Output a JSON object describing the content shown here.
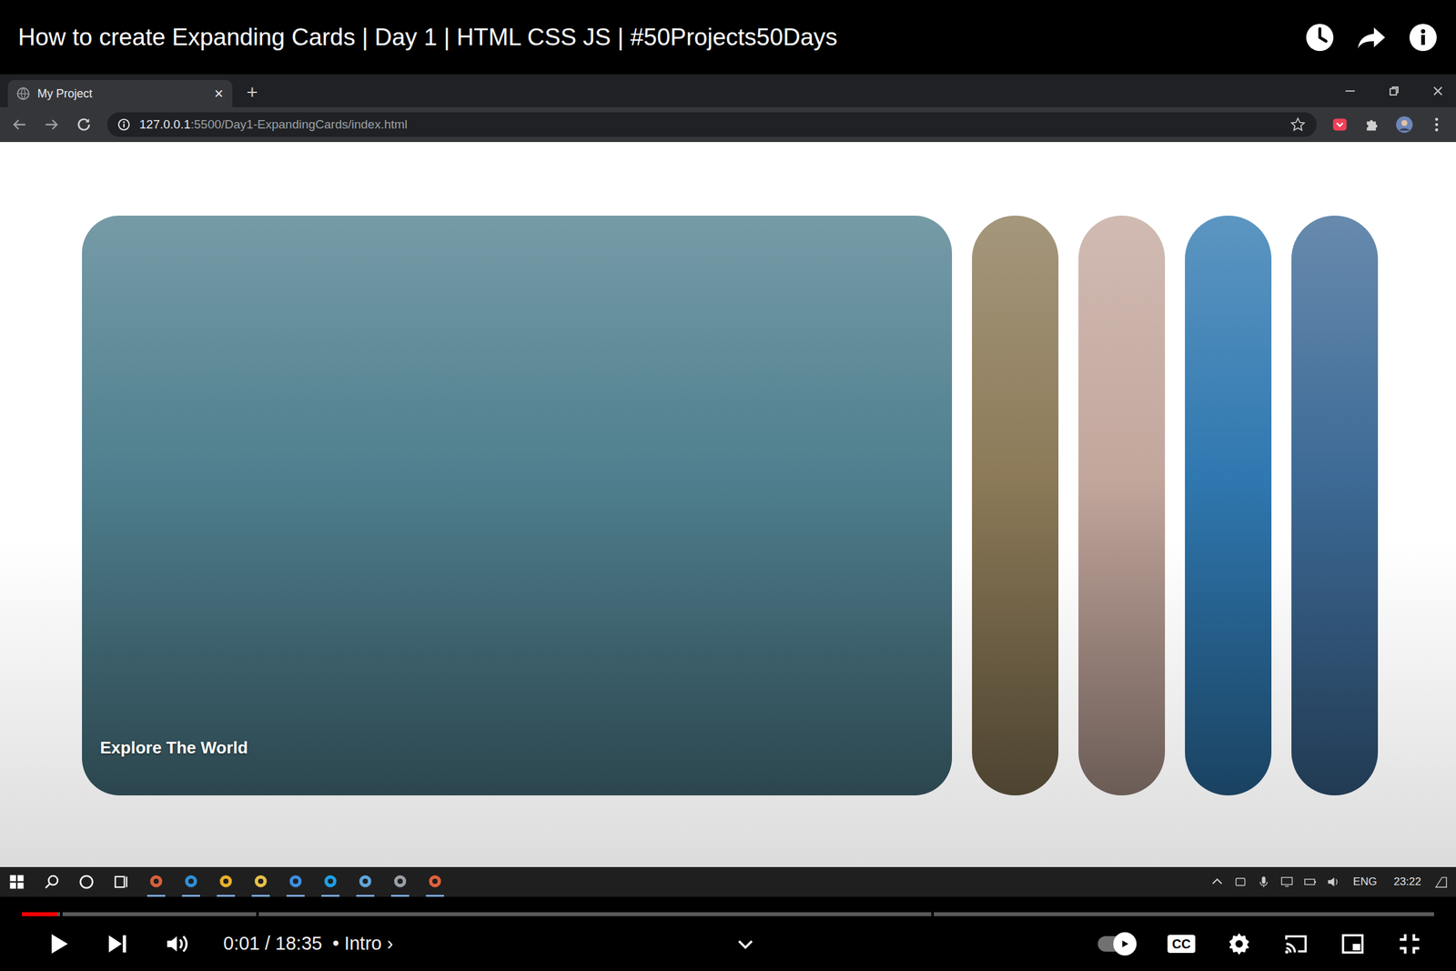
{
  "video": {
    "title": "How to create Expanding Cards | Day 1 | HTML CSS JS | #50Projects50Days"
  },
  "browser": {
    "tab": {
      "label": "My Project",
      "close": "×"
    },
    "new_tab": "+",
    "url": {
      "host": "127.0.0.1",
      "rest": ":5500/Day1-ExpandingCards/index.html"
    }
  },
  "cards": [
    {
      "title": "Explore The World",
      "selected": true,
      "color": "#4f7f8e"
    },
    {
      "title": "",
      "selected": false,
      "color": "#8c7a58"
    },
    {
      "title": "",
      "selected": false,
      "color": "#c3a79d"
    },
    {
      "title": "",
      "selected": false,
      "color": "#2f78b0"
    },
    {
      "title": "",
      "selected": false,
      "color": "#3d6a96"
    }
  ],
  "taskbar": {
    "language": "ENG",
    "time": "23:22"
  },
  "player": {
    "time": "0:01 / 18:35",
    "chapter": "• Intro",
    "chapter_arrow": "›",
    "level": 0.025,
    "segments": [
      0.027,
      0.138,
      0.479,
      0.356
    ],
    "autoplay": true,
    "captions_label": "CC"
  }
}
